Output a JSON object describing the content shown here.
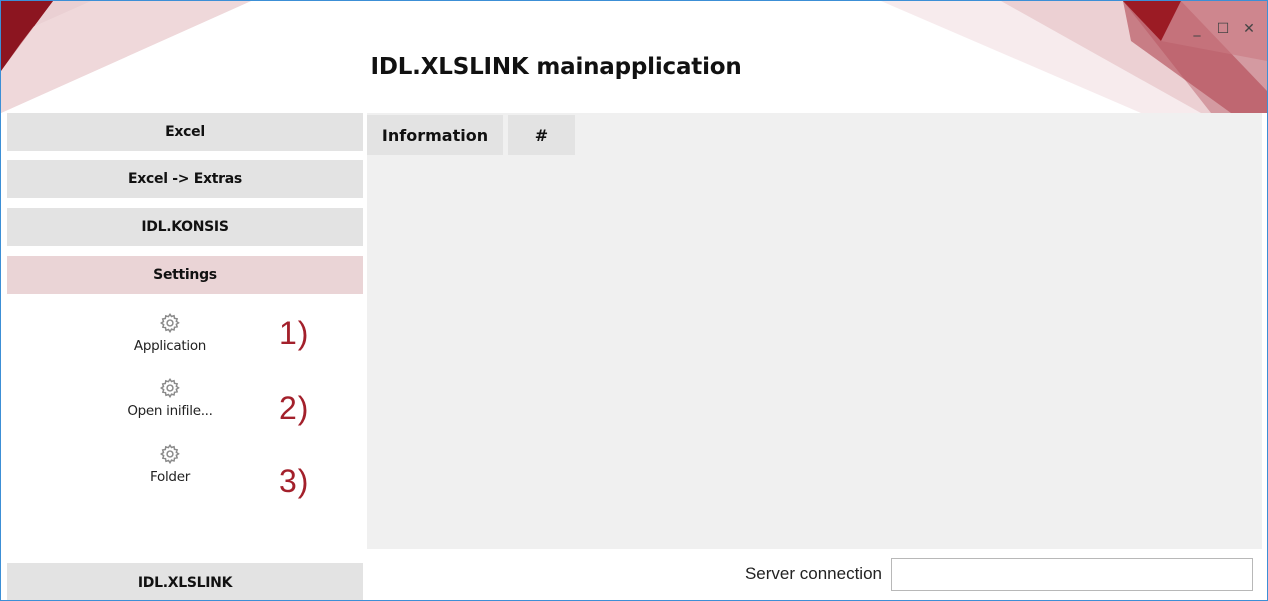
{
  "window": {
    "title": "IDL.XLSLINK mainapplication",
    "controls": {
      "minimize_icon": "_",
      "maximize_icon": "☐",
      "close_icon": "✕"
    },
    "accent_color": "#a3202b"
  },
  "sidebar": {
    "buttons": [
      {
        "label": "Excel"
      },
      {
        "label": "Excel -> Extras"
      },
      {
        "label": "IDL.KONSIS"
      },
      {
        "label": "Settings",
        "active": true
      }
    ],
    "settings_items": [
      {
        "label": "Application",
        "icon": "gear-icon",
        "annotation": "1)"
      },
      {
        "label": "Open inifile...",
        "icon": "gear-icon",
        "annotation": "2)"
      },
      {
        "label": "Folder",
        "icon": "gear-icon",
        "annotation": "3)"
      }
    ],
    "bottom_button": {
      "label": "IDL.XLSLINK"
    }
  },
  "main": {
    "tabs": [
      {
        "label": "Information"
      },
      {
        "label": "#"
      }
    ]
  },
  "status": {
    "server_label": "Server connection",
    "server_value": ""
  }
}
